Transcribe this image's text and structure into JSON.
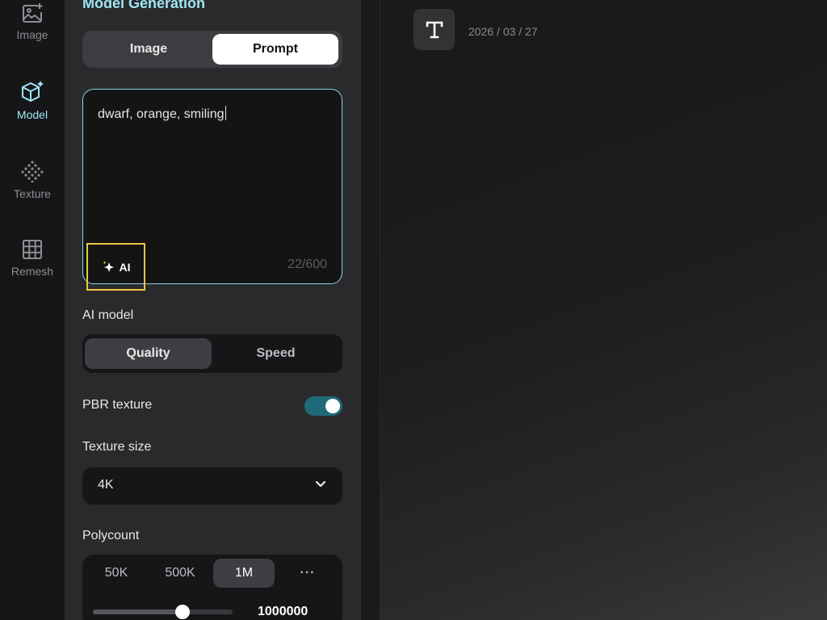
{
  "rail": {
    "items": [
      {
        "label": "Image",
        "icon": "image-plus-icon",
        "active": false
      },
      {
        "label": "Model",
        "icon": "cube-sparkle-icon",
        "active": true
      },
      {
        "label": "Texture",
        "icon": "texture-dots-icon",
        "active": false
      },
      {
        "label": "Remesh",
        "icon": "grid-icon",
        "active": false
      }
    ]
  },
  "panel": {
    "title": "Model Generation",
    "mode_toggle": {
      "options": [
        "Image",
        "Prompt"
      ],
      "selected": "Prompt"
    },
    "prompt": {
      "value": "dwarf, orange, smiling",
      "counter": "22/600",
      "ai_button_label": "AI"
    },
    "ai_model": {
      "label": "AI model",
      "options": [
        "Quality",
        "Speed"
      ],
      "selected": "Quality"
    },
    "pbr_texture": {
      "label": "PBR texture",
      "enabled": true
    },
    "texture_size": {
      "label": "Texture size",
      "value": "4K"
    },
    "polycount": {
      "label": "Polycount",
      "options": [
        "50K",
        "500K",
        "1M",
        "···"
      ],
      "selected": "1M",
      "value": "1000000",
      "slider_fraction": 0.64
    }
  },
  "history": {
    "items": [
      {
        "type_icon": "text-type-icon",
        "date": "2026 / 03 / 27"
      }
    ]
  },
  "colors": {
    "accent": "#9ee6f2",
    "highlight": "#f0c541",
    "toggle_on": "#1f6a79"
  }
}
